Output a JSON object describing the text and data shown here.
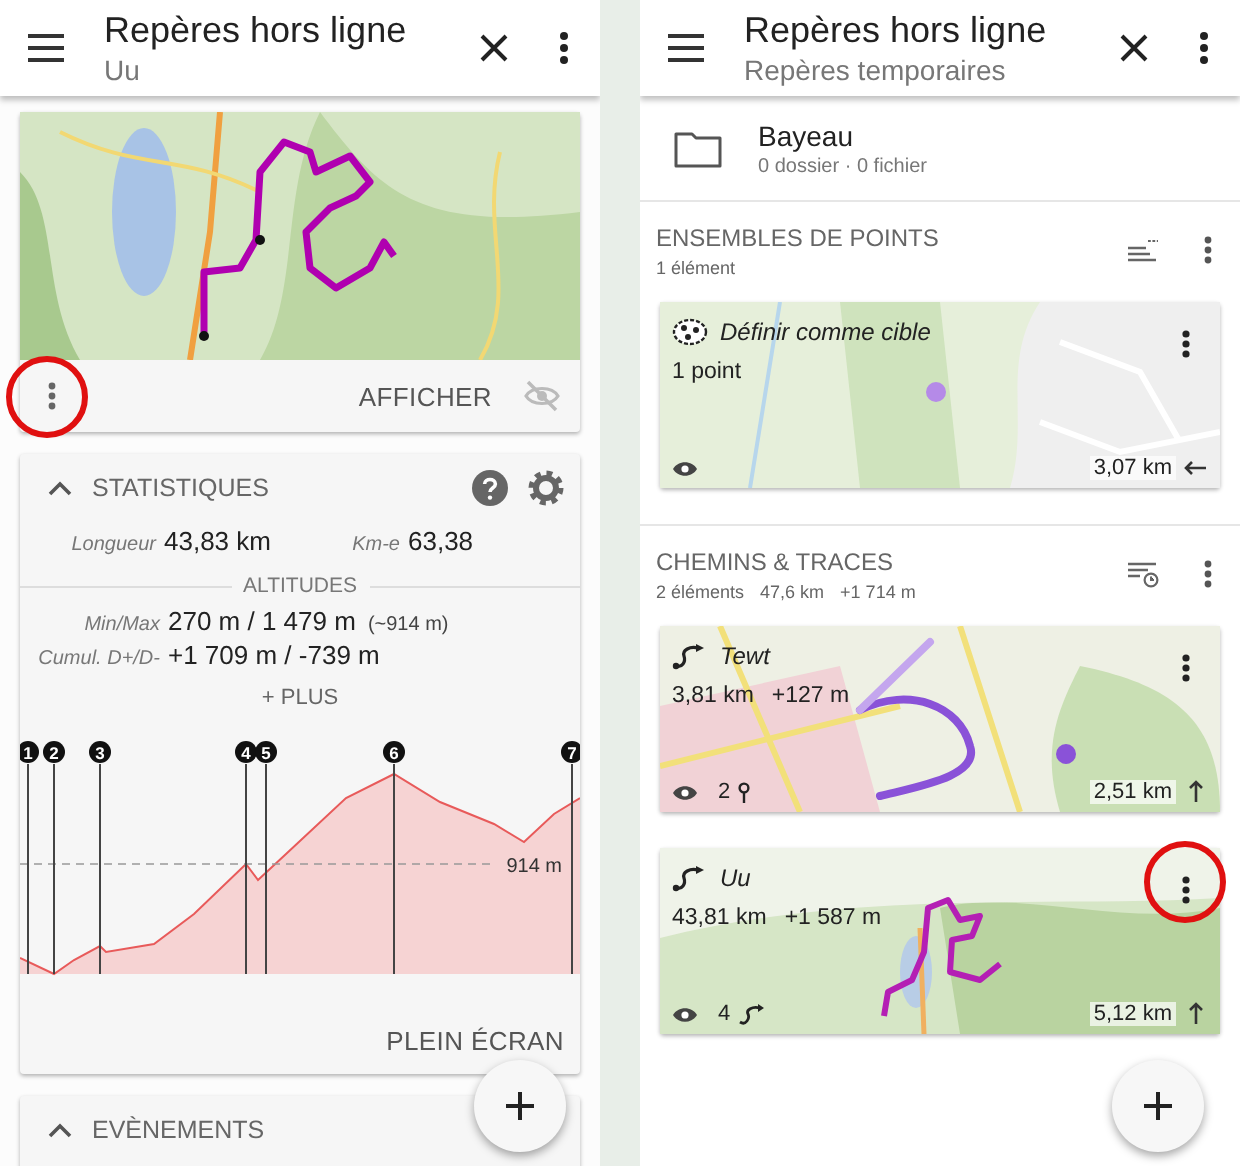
{
  "left_screen": {
    "app_bar": {
      "title": "Repères hors ligne",
      "subtitle": "Uu"
    },
    "map_card": {
      "action": "AFFICHER",
      "menu_highlighted": true
    },
    "statistics": {
      "title": "STATISTIQUES",
      "expanded": true,
      "summary": [
        {
          "label": "Longueur",
          "value": "43,83 km"
        },
        {
          "label": "Km-e",
          "value": "63,38"
        }
      ],
      "altitudes_heading": "ALTITUDES",
      "altitudes": [
        {
          "label": "Min/Max",
          "value": "270 m / 1 479 m",
          "note": "(~914 m)"
        },
        {
          "label": "Cumul. D+/D-",
          "value": "+1 709 m / -739 m"
        }
      ],
      "more": "+ PLUS",
      "profile": {
        "markers": [
          "1",
          "2",
          "3",
          "4",
          "5",
          "6",
          "7"
        ],
        "reference_label": "914 m"
      },
      "fullscreen": "PLEIN ÉCRAN"
    },
    "events": {
      "title": "EVÈNEMENTS",
      "expanded": true
    }
  },
  "right_screen": {
    "app_bar": {
      "title": "Repères hors ligne",
      "subtitle": "Repères temporaires"
    },
    "folder": {
      "name": "Bayeau",
      "info": "0 dossier · 0 fichier"
    },
    "sections": [
      {
        "kind": "points",
        "title": "ENSEMBLES DE POINTS",
        "info": [
          "1 élément"
        ],
        "cards": [
          {
            "kind": "points",
            "name": "Définir comme cible",
            "summary": [
              "1 point"
            ],
            "distance": "3,07 km",
            "menu_highlighted": false
          }
        ]
      },
      {
        "kind": "tracks",
        "title": "CHEMINS & TRACES",
        "info": [
          "2 éléments",
          "47,6 km",
          "+1 714 m"
        ],
        "cards": [
          {
            "kind": "track",
            "name": "Tewt",
            "summary": [
              "3,81 km",
              "+127 m"
            ],
            "count": {
              "kind": "waypoints",
              "value": "2"
            },
            "distance": "2,51 km",
            "menu_highlighted": false
          },
          {
            "kind": "track",
            "name": "Uu",
            "summary": [
              "43,81 km",
              "+1 587 m"
            ],
            "count": {
              "kind": "tracks",
              "value": "4"
            },
            "distance": "5,12 km",
            "menu_highlighted": true
          }
        ]
      }
    ]
  }
}
